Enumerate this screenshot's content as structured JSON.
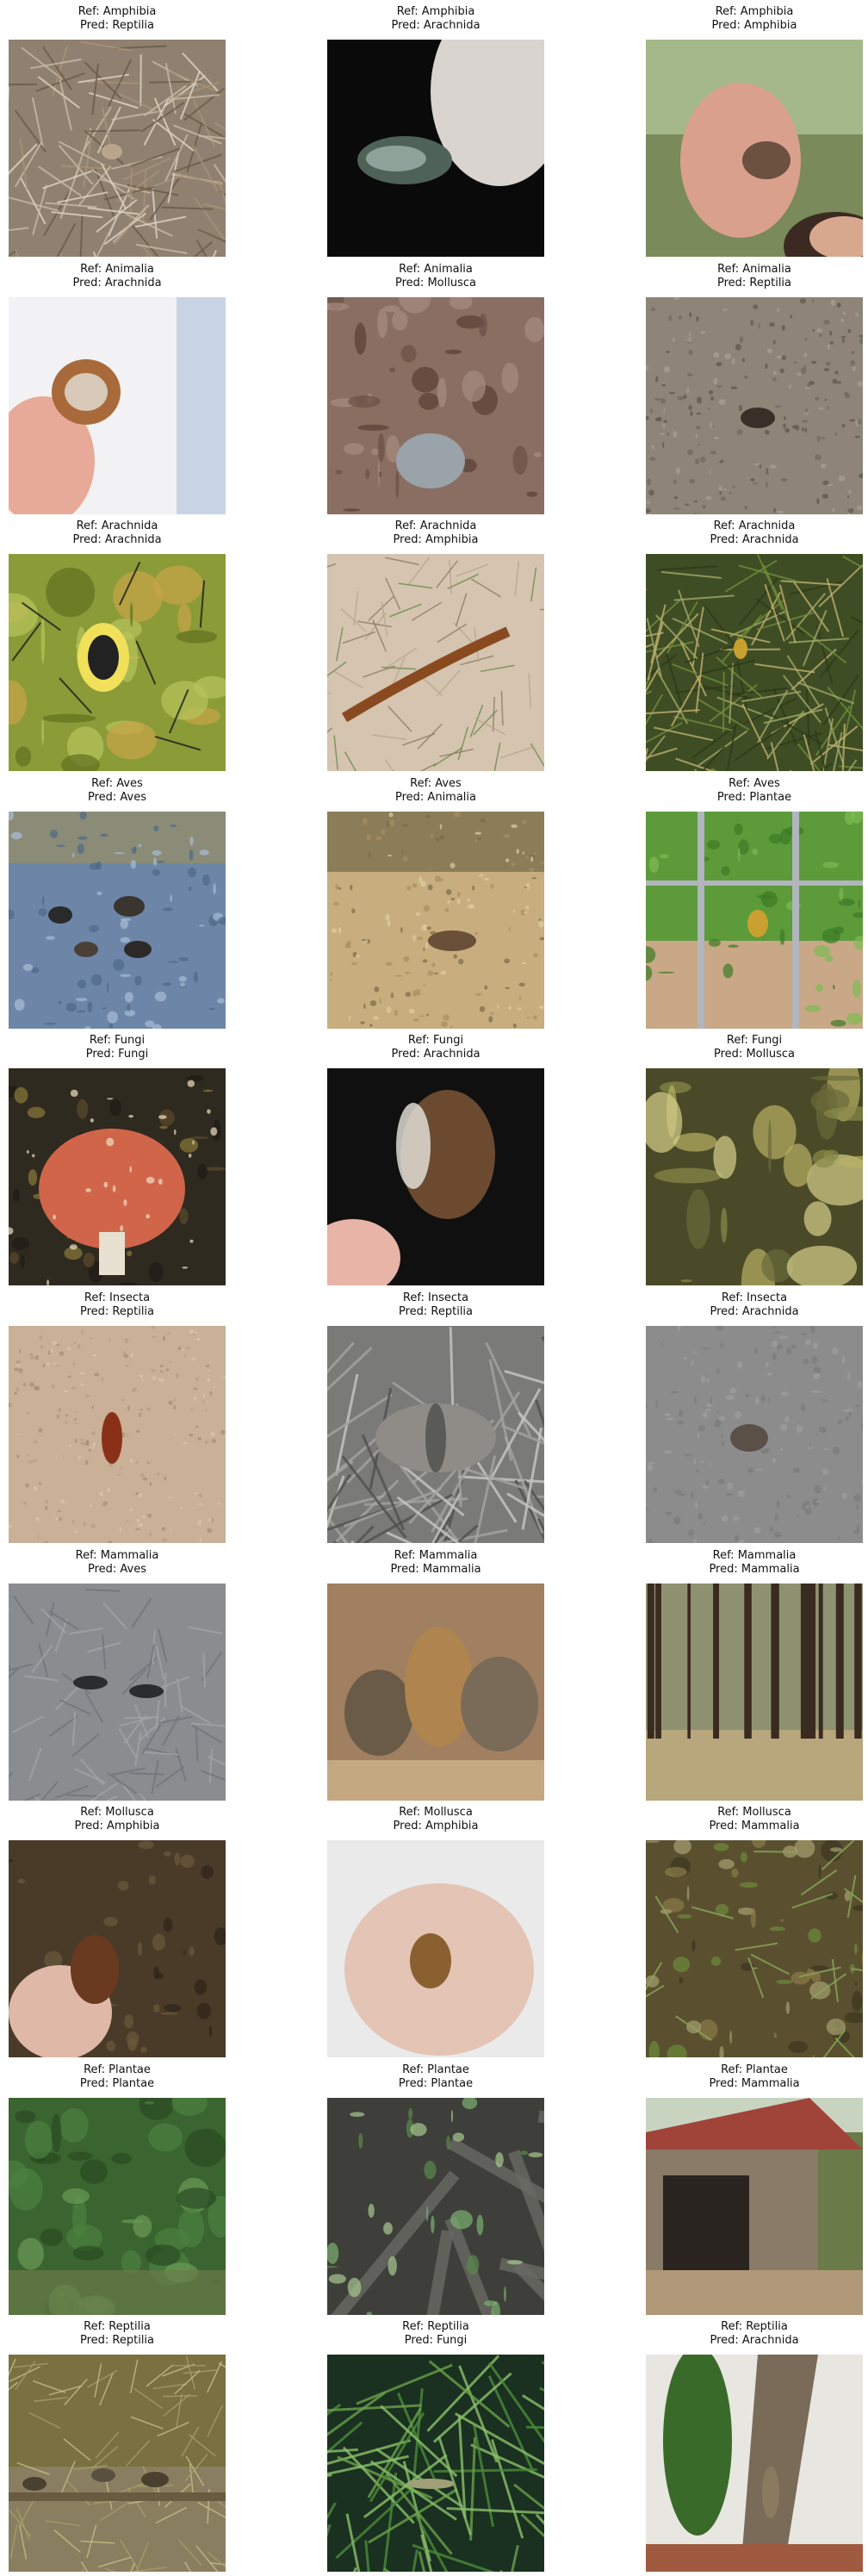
{
  "figure": {
    "panels": [
      {
        "ref": "Ref: Amphibia",
        "pred": "Pred: Reptilia",
        "scene": "dry-grass"
      },
      {
        "ref": "Ref: Amphibia",
        "pred": "Pred: Arachnida",
        "scene": "hand-dark"
      },
      {
        "ref": "Ref: Amphibia",
        "pred": "Pred: Amphibia",
        "scene": "hand-face"
      },
      {
        "ref": "Ref: Animalia",
        "pred": "Pred: Arachnida",
        "scene": "crab-hand"
      },
      {
        "ref": "Ref: Animalia",
        "pred": "Pred: Mollusca",
        "scene": "rocks"
      },
      {
        "ref": "Ref: Animalia",
        "pred": "Pred: Reptilia",
        "scene": "mud"
      },
      {
        "ref": "Ref: Arachnida",
        "pred": "Pred: Arachnida",
        "scene": "spider-web"
      },
      {
        "ref": "Ref: Arachnida",
        "pred": "Pred: Amphibia",
        "scene": "scorpion-sand"
      },
      {
        "ref": "Ref: Arachnida",
        "pred": "Pred: Arachnida",
        "scene": "spider-grass"
      },
      {
        "ref": "Ref: Aves",
        "pred": "Pred: Aves",
        "scene": "ducks-water"
      },
      {
        "ref": "Ref: Aves",
        "pred": "Pred: Animalia",
        "scene": "bird-ground"
      },
      {
        "ref": "Ref: Aves",
        "pred": "Pred: Plantae",
        "scene": "fence-bird"
      },
      {
        "ref": "Ref: Fungi",
        "pred": "Pred: Fungi",
        "scene": "mushroom"
      },
      {
        "ref": "Ref: Fungi",
        "pred": "Pred: Arachnida",
        "scene": "fungus-hand"
      },
      {
        "ref": "Ref: Fungi",
        "pred": "Pred: Mollusca",
        "scene": "lichen"
      },
      {
        "ref": "Ref: Insecta",
        "pred": "Pred: Reptilia",
        "scene": "insect-sand"
      },
      {
        "ref": "Ref: Insecta",
        "pred": "Pred: Reptilia",
        "scene": "moth-wood"
      },
      {
        "ref": "Ref: Insecta",
        "pred": "Pred: Arachnida",
        "scene": "moth-grey"
      },
      {
        "ref": "Ref: Mammalia",
        "pred": "Pred: Aves",
        "scene": "dolphins"
      },
      {
        "ref": "Ref: Mammalia",
        "pred": "Pred: Mammalia",
        "scene": "marsupials"
      },
      {
        "ref": "Ref: Mammalia",
        "pred": "Pred: Mammalia",
        "scene": "forest"
      },
      {
        "ref": "Ref: Mollusca",
        "pred": "Pred: Amphibia",
        "scene": "shell-hand"
      },
      {
        "ref": "Ref: Mollusca",
        "pred": "Pred: Amphibia",
        "scene": "snail-palm"
      },
      {
        "ref": "Ref: Mollusca",
        "pred": "Pred: Mammalia",
        "scene": "stream-rocks"
      },
      {
        "ref": "Ref: Plantae",
        "pred": "Pred: Plantae",
        "scene": "leaves"
      },
      {
        "ref": "Ref: Plantae",
        "pred": "Pred: Plantae",
        "scene": "vine-fence"
      },
      {
        "ref": "Ref: Plantae",
        "pred": "Pred: Mammalia",
        "scene": "shed"
      },
      {
        "ref": "Ref: Reptilia",
        "pred": "Pred: Reptilia",
        "scene": "turtles"
      },
      {
        "ref": "Ref: Reptilia",
        "pred": "Pred: Fungi",
        "scene": "lizard-fronds"
      },
      {
        "ref": "Ref: Reptilia",
        "pred": "Pred: Arachnida",
        "scene": "lizard-tree"
      }
    ]
  }
}
